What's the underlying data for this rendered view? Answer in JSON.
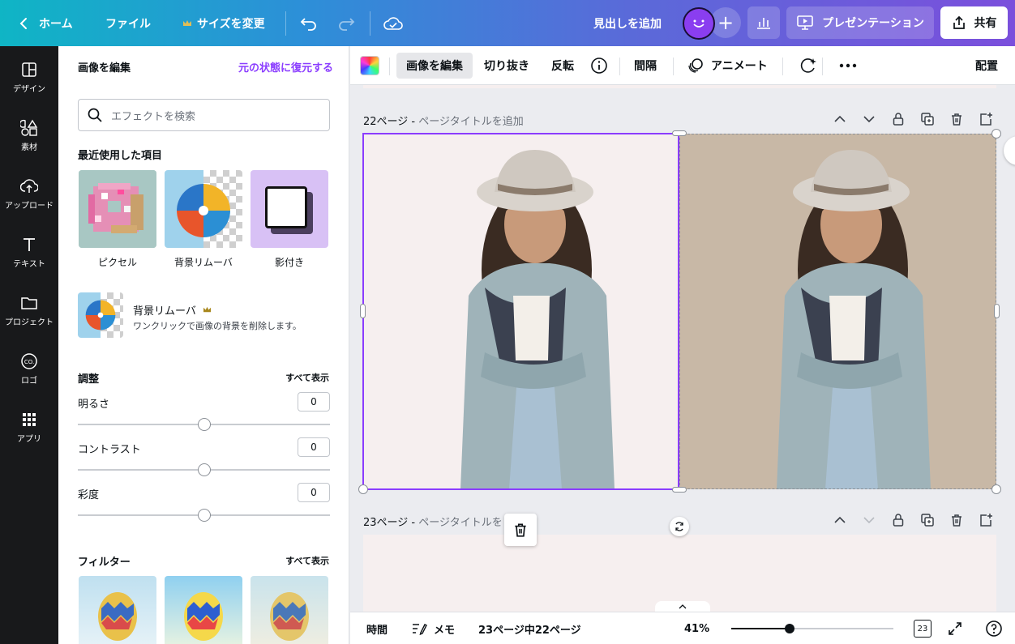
{
  "topbar": {
    "home": "ホーム",
    "file": "ファイル",
    "resize": "サイズを変更",
    "add_heading": "見出しを追加",
    "present": "プレゼンテーション",
    "share": "共有"
  },
  "rail": [
    {
      "label": "デザイン",
      "icon": "design-icon"
    },
    {
      "label": "素材",
      "icon": "elements-icon"
    },
    {
      "label": "アップロード",
      "icon": "upload-icon"
    },
    {
      "label": "テキスト",
      "icon": "text-icon"
    },
    {
      "label": "プロジェクト",
      "icon": "folder-icon"
    },
    {
      "label": "ロゴ",
      "icon": "logo-icon"
    },
    {
      "label": "アプリ",
      "icon": "apps-icon"
    }
  ],
  "panel": {
    "title": "画像を編集",
    "restore": "元の状態に復元する",
    "search_placeholder": "エフェクトを検索",
    "recent_title": "最近使用した項目",
    "recent": [
      {
        "label": "ピクセル"
      },
      {
        "label": "背景リムーバ"
      },
      {
        "label": "影付き"
      }
    ],
    "bg_remover": {
      "title": "背景リムーバ",
      "desc": "ワンクリックで画像の背景を削除します。"
    },
    "adjust_title": "調整",
    "see_all": "すべて表示",
    "adjust": [
      {
        "label": "明るさ",
        "value": "0",
        "level": 0.5
      },
      {
        "label": "コントラスト",
        "value": "0",
        "level": 0.5
      },
      {
        "label": "彩度",
        "value": "0",
        "level": 0.5
      }
    ],
    "filter_title": "フィルター",
    "filter_see_all": "すべて表示"
  },
  "toolbar": {
    "edit_image": "画像を編集",
    "crop": "切り抜き",
    "flip": "反転",
    "spacing": "間隔",
    "animate": "アニメート",
    "position": "配置"
  },
  "canvas": {
    "page22_num": "22ページ",
    "page22_title": "ページタイトルを追加",
    "page23_num": "23ページ",
    "page23_title": "ページタイトルを"
  },
  "bottombar": {
    "time": "時間",
    "notes": "メモ",
    "page_info": "23ページ中22ページ",
    "zoom": "41%",
    "zoom_level": 0.36,
    "page_count": "23"
  },
  "colors": {
    "accent": "#8b3dff",
    "rail_bg": "#18191b"
  }
}
